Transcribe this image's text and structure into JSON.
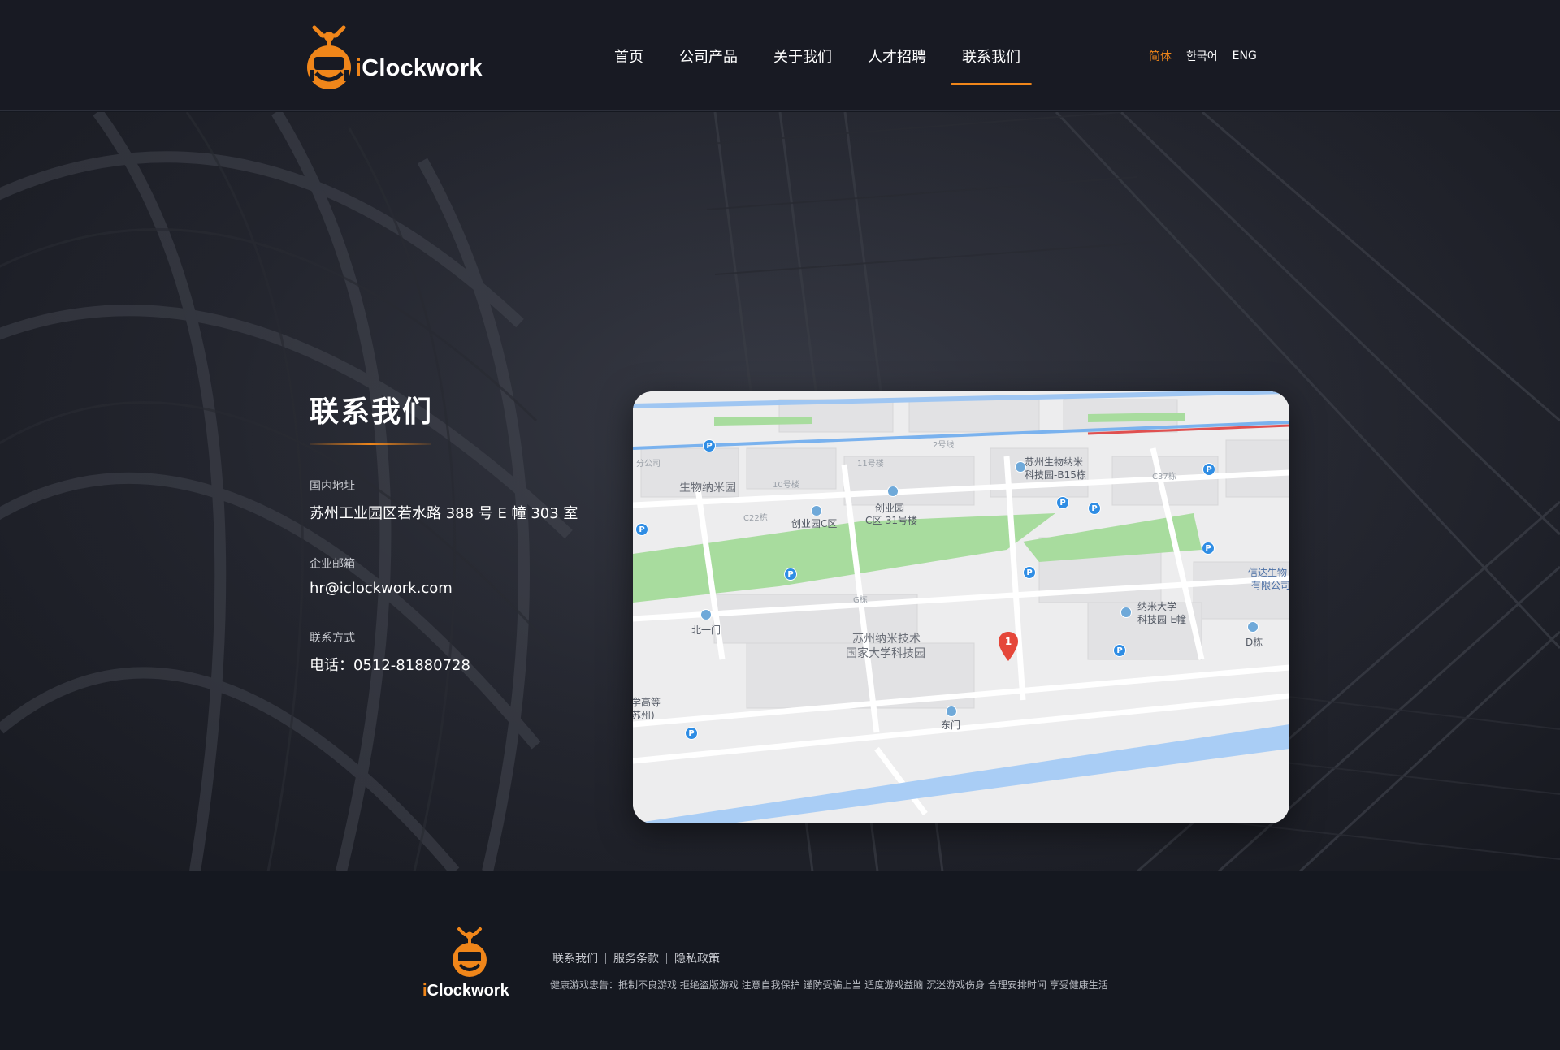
{
  "header": {
    "logo": {
      "prefix": "i",
      "name": "Clockwork"
    },
    "nav": [
      {
        "label": "首页"
      },
      {
        "label": "公司产品"
      },
      {
        "label": "关于我们"
      },
      {
        "label": "人才招聘"
      },
      {
        "label": "联系我们",
        "active": true
      }
    ],
    "languages": [
      {
        "label": "简体",
        "active": true
      },
      {
        "label": "한국어"
      },
      {
        "label": "ENG"
      }
    ]
  },
  "contact": {
    "title": "联系我们",
    "fields": [
      {
        "label": "国内地址",
        "value": "苏州工业园区若水路 388 号 E 幢 303 室"
      },
      {
        "label": "企业邮箱",
        "value": "hr@iclockwork.com"
      },
      {
        "label": "联系方式",
        "value": "电话：0512-81880728"
      }
    ]
  },
  "map": {
    "marker_label": "1",
    "labels": {
      "bio_park": "生物纳米园",
      "bldg_11": "11号楼",
      "bldg_10": "10号楼",
      "c22": "C22栋",
      "park_c": "创业园C区",
      "park_c31_1": "创业园",
      "park_c31_2": "C区-31号楼",
      "nano_b15_1": "苏州生物纳米",
      "nano_b15_2": "科技园-B15栋",
      "c37": "C37栋",
      "xinda_1": "信达生物",
      "xinda_2": "有限公司",
      "g_bldg": "G栋",
      "north_gate": "北一门",
      "nano_univ_1": "苏州纳米技术",
      "nano_univ_2": "国家大学科技园",
      "nano_e_1": "纳米大学",
      "nano_e_2": "科技园-E幢",
      "d_bldg": "D栋",
      "east_gate": "东门",
      "school_1": "学高等",
      "school_2": "苏州)",
      "metro": "2号线",
      "branch": "分公司"
    },
    "parking_symbol": "P"
  },
  "footer": {
    "logo": {
      "prefix": "i",
      "name": "Clockwork"
    },
    "links": [
      {
        "label": "联系我们"
      },
      {
        "label": "服务条款"
      },
      {
        "label": "隐私政策"
      }
    ],
    "notice": "健康游戏忠告：抵制不良游戏 拒绝盗版游戏 注意自我保护 谨防受骗上当 适度游戏益脑 沉迷游戏伤身 合理安排时间 享受健康生活"
  },
  "colors": {
    "accent": "#f0861a",
    "background": "#181a23",
    "map_green": "#8fd58a",
    "map_water": "#a9cdf5",
    "parking": "#2f8de4",
    "marker": "#e5473a"
  }
}
